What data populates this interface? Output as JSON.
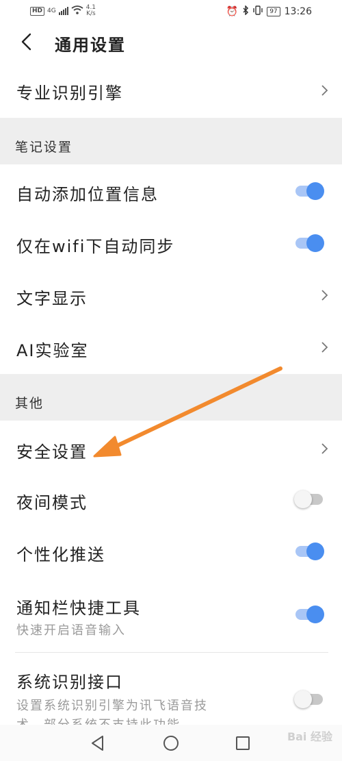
{
  "status_bar": {
    "hd": "HD",
    "net": "4G",
    "speed_value": "4.1",
    "speed_unit": "K/s",
    "battery": "97",
    "time": "13:26"
  },
  "header": {
    "title": "通用设置"
  },
  "rows": {
    "engine": "专业识别引擎",
    "section_notes": "笔记设置",
    "auto_location": "自动添加位置信息",
    "wifi_sync": "仅在wifi下自动同步",
    "text_display": "文字显示",
    "ai_lab": "AI实验室",
    "section_other": "其他",
    "security": "安全设置",
    "night_mode": "夜间模式",
    "personal_push": "个性化推送",
    "notif_tool": "通知栏快捷工具",
    "notif_tool_sub": "快速开启语音输入",
    "sys_engine": "系统识别接口",
    "sys_engine_sub1": "设置系统识别引擎为讯飞语音技",
    "sys_engine_sub2": "术，部分系统不支持此功能"
  },
  "toggles": {
    "auto_location": true,
    "wifi_sync": true,
    "night_mode": false,
    "personal_push": true,
    "notif_tool": true,
    "sys_engine": false
  },
  "watermark": "Bai 经验",
  "colors": {
    "accent": "#4a8ef0",
    "accent_track": "#a9c6f6",
    "section_bg": "#eeeeee",
    "arrow": "#f28a2e"
  }
}
